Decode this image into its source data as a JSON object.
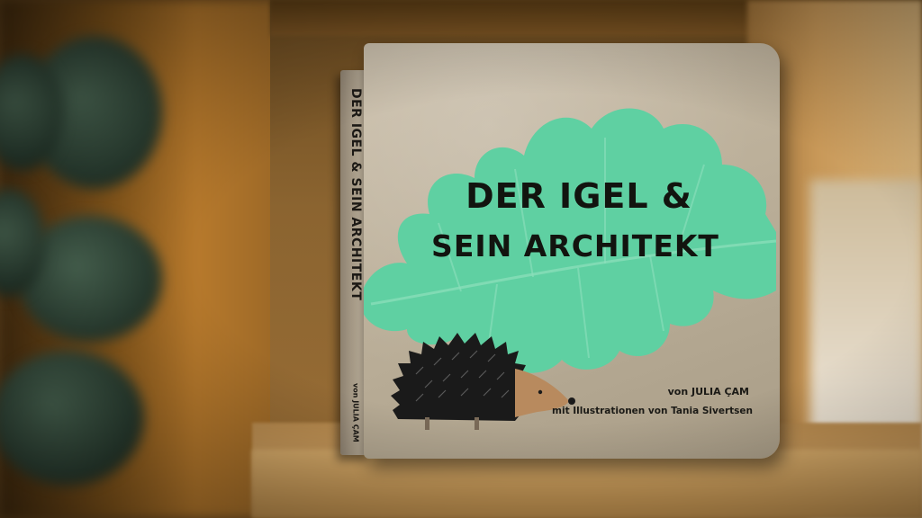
{
  "book": {
    "title_line_1": "DER IGEL &",
    "title_line_2": "SEIN ARCHITEKT",
    "spine_title": "DER IGEL & SEIN ARCHITEKT",
    "spine_author": "von JULIA ÇAM",
    "author": "von JULIA ÇAM",
    "illustrator": "mit Illustrationen von Tania Sivertsen"
  },
  "colors": {
    "cover": "#b9ad97",
    "leaf": "#5fd0a2",
    "title_text": "#12140f",
    "hedgehog_spines": "#1a1a1a",
    "hedgehog_face": "#b88a5e"
  },
  "objects": {
    "leaf_icon": "oak-leaf-icon",
    "hedgehog_icon": "hedgehog-icon",
    "plant": "plant-leaves"
  }
}
